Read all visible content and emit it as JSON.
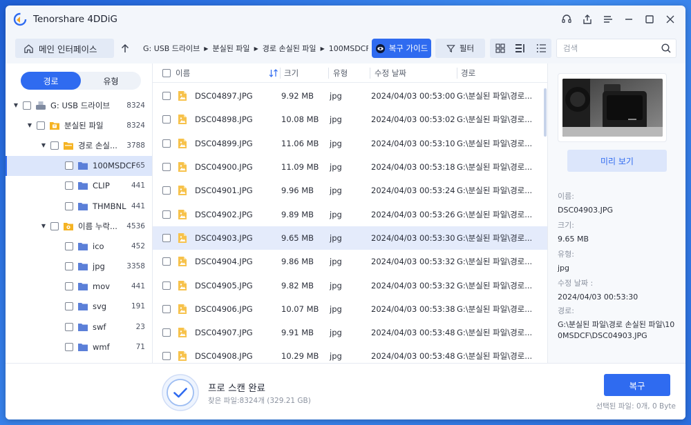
{
  "app": {
    "title": "Tenorshare 4DDiG"
  },
  "colors": {
    "accent": "#2f6bf0",
    "folder": "#f5b323",
    "selected_row": "#e4ebfb"
  },
  "toolbar": {
    "home_label": "메인 인터페이스",
    "breadcrumb": [
      "G: USB 드라이브",
      "분실된 파일",
      "경로 손실된 파일",
      "100MSDCF"
    ],
    "guide_label": "복구 가이드",
    "filter_label": "필터",
    "search_placeholder": "검색"
  },
  "sidebar": {
    "tabs": [
      "경로",
      "유형"
    ],
    "tree": [
      {
        "label": "G: USB 드라이브",
        "count": "8324",
        "icon": "drive-icon"
      },
      {
        "label": "분실된 파일",
        "count": "8324",
        "icon": "lost-folder-icon"
      },
      {
        "label": "경로 손실...",
        "count": "3788",
        "icon": "folder-icon"
      },
      {
        "label": "100MSDCF",
        "count": "65",
        "icon": "folder-icon"
      },
      {
        "label": "CLIP",
        "count": "441",
        "icon": "folder-icon"
      },
      {
        "label": "THMBNL",
        "count": "441",
        "icon": "folder-icon"
      },
      {
        "label": "이름 누락...",
        "count": "4536",
        "icon": "lost-folder-icon"
      },
      {
        "label": "ico",
        "count": "452",
        "icon": "folder-icon"
      },
      {
        "label": "jpg",
        "count": "3358",
        "icon": "folder-icon"
      },
      {
        "label": "mov",
        "count": "441",
        "icon": "folder-icon"
      },
      {
        "label": "svg",
        "count": "191",
        "icon": "folder-icon"
      },
      {
        "label": "swf",
        "count": "23",
        "icon": "folder-icon"
      },
      {
        "label": "wmf",
        "count": "71",
        "icon": "folder-icon"
      }
    ]
  },
  "file_list": {
    "columns": {
      "name": "이름",
      "size": "크기",
      "type": "유형",
      "date": "수정 날짜",
      "path": "경로"
    },
    "rows": [
      {
        "name": "DSC04897.JPG",
        "size": "9.92 MB",
        "type": "jpg",
        "date": "2024/04/03 00:53:00",
        "path": "G:\\분실된 파일\\경로..."
      },
      {
        "name": "DSC04898.JPG",
        "size": "10.08 MB",
        "type": "jpg",
        "date": "2024/04/03 00:53:02",
        "path": "G:\\분실된 파일\\경로..."
      },
      {
        "name": "DSC04899.JPG",
        "size": "11.06 MB",
        "type": "jpg",
        "date": "2024/04/03 00:53:10",
        "path": "G:\\분실된 파일\\경로..."
      },
      {
        "name": "DSC04900.JPG",
        "size": "11.09 MB",
        "type": "jpg",
        "date": "2024/04/03 00:53:18",
        "path": "G:\\분실된 파일\\경로..."
      },
      {
        "name": "DSC04901.JPG",
        "size": "9.96 MB",
        "type": "jpg",
        "date": "2024/04/03 00:53:24",
        "path": "G:\\분실된 파일\\경로..."
      },
      {
        "name": "DSC04902.JPG",
        "size": "9.89 MB",
        "type": "jpg",
        "date": "2024/04/03 00:53:26",
        "path": "G:\\분실된 파일\\경로..."
      },
      {
        "name": "DSC04903.JPG",
        "size": "9.65 MB",
        "type": "jpg",
        "date": "2024/04/03 00:53:30",
        "path": "G:\\분실된 파일\\경로..."
      },
      {
        "name": "DSC04904.JPG",
        "size": "9.86 MB",
        "type": "jpg",
        "date": "2024/04/03 00:53:32",
        "path": "G:\\분실된 파일\\경로..."
      },
      {
        "name": "DSC04905.JPG",
        "size": "9.82 MB",
        "type": "jpg",
        "date": "2024/04/03 00:53:32",
        "path": "G:\\분실된 파일\\경로..."
      },
      {
        "name": "DSC04906.JPG",
        "size": "10.07 MB",
        "type": "jpg",
        "date": "2024/04/03 00:53:38",
        "path": "G:\\분실된 파일\\경로..."
      },
      {
        "name": "DSC04907.JPG",
        "size": "9.91 MB",
        "type": "jpg",
        "date": "2024/04/03 00:53:48",
        "path": "G:\\분실된 파일\\경로..."
      },
      {
        "name": "DSC04908.JPG",
        "size": "10.29 MB",
        "type": "jpg",
        "date": "2024/04/03 00:53:48",
        "path": "G:\\분실된 파일\\경로..."
      }
    ]
  },
  "details": {
    "preview_label": "미리 보기",
    "name_label": "이름:",
    "name": "DSC04903.JPG",
    "size_label": "크기:",
    "size": "9.65 MB",
    "type_label": "유형:",
    "type": "jpg",
    "date_label": "수정 날짜 :",
    "date": "2024/04/03 00:53:30",
    "path_label": "경로:",
    "path": "G:\\분실된 파일\\경로 손실된 파일\\100MSDCF\\DSC04903.JPG"
  },
  "footer": {
    "scan_title": "프로 스캔 완료",
    "scan_summary": "찾은 파일:8324개 (329.21 GB)",
    "recover_label": "복구",
    "selected_info": "선택된 파일: 0개, 0 Byte"
  }
}
